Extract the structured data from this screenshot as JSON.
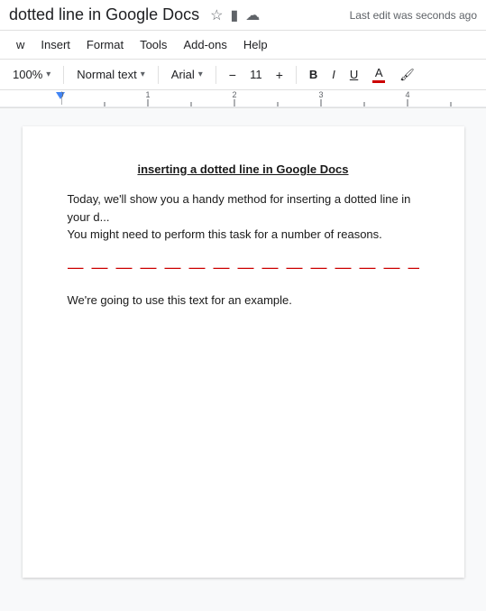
{
  "titleBar": {
    "title": "dotted line in Google Docs",
    "lastEdit": "Last edit was seconds ago"
  },
  "menuBar": {
    "items": [
      "w",
      "Insert",
      "Format",
      "Tools",
      "Add-ons",
      "Help"
    ]
  },
  "toolbar": {
    "zoom": "100%",
    "style": "Normal text",
    "font": "Arial",
    "fontSize": "11",
    "boldLabel": "B",
    "italicLabel": "I",
    "underlineLabel": "U"
  },
  "document": {
    "title": "inserting a dotted line in Google Docs",
    "para1": "Today, we'll show you a handy method for inserting a dotted line in your d... You might need to perform this task for a number of reasons.",
    "para2": "We're going to use this text for an example.",
    "dottedLine": "— — — — — — — — — — — — — — — —"
  }
}
